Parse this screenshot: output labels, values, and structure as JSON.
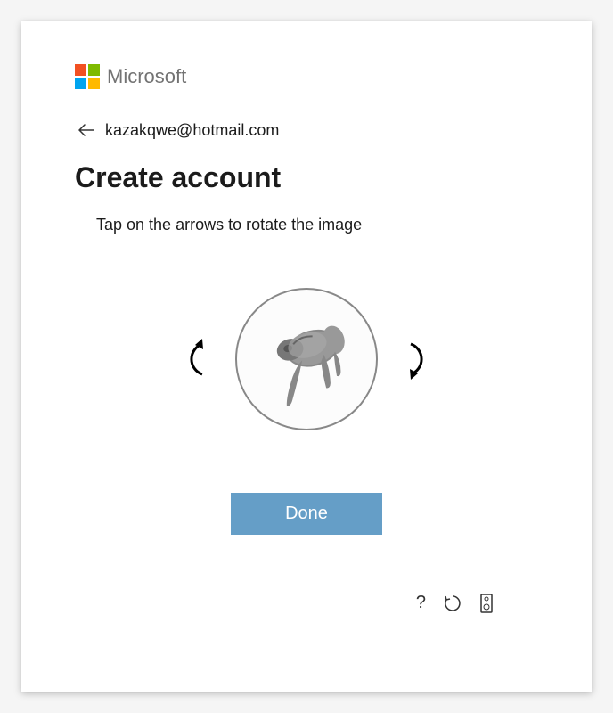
{
  "brand": {
    "name": "Microsoft"
  },
  "account": {
    "email": "kazakqwe@hotmail.com"
  },
  "page": {
    "title": "Create account",
    "instruction": "Tap on the arrows to rotate the image"
  },
  "captcha": {
    "rotate_left_label": "rotate-left",
    "rotate_right_label": "rotate-right",
    "done_label": "Done"
  },
  "footer": {
    "help_label": "?",
    "refresh_label": "refresh",
    "audio_label": "audio"
  }
}
